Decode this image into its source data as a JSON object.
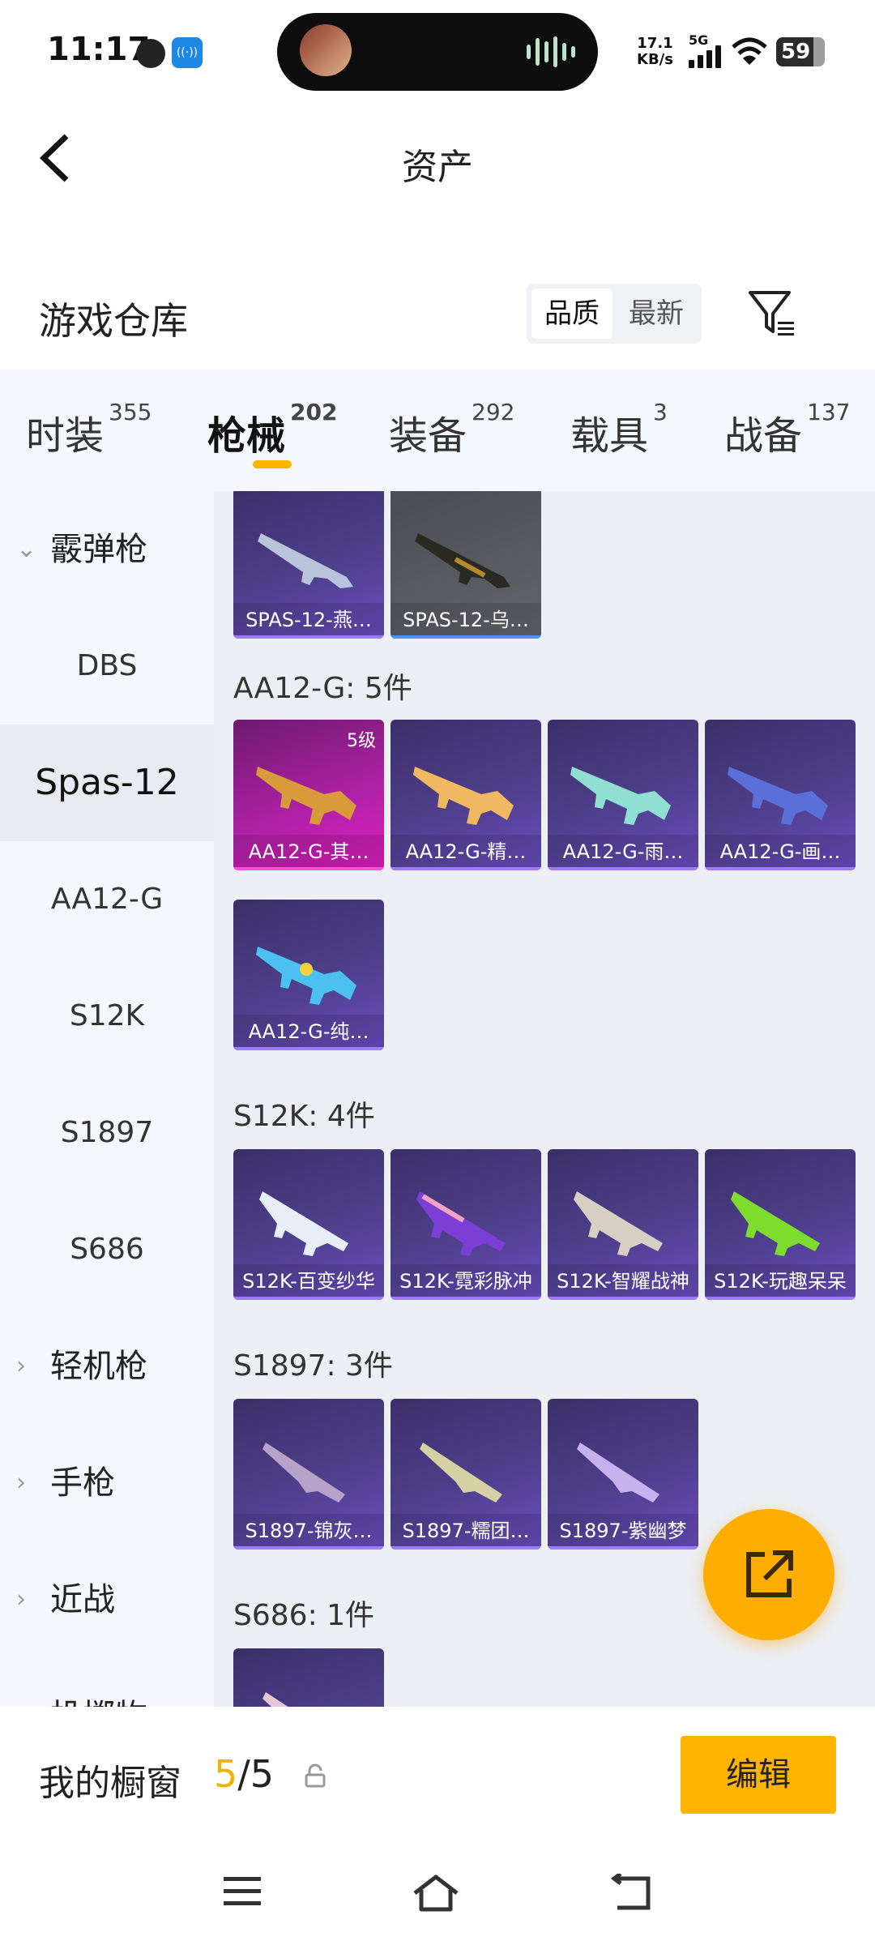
{
  "status_bar": {
    "time": "11:17",
    "net_speed_value": "17.1",
    "net_speed_unit": "KB/s",
    "network": "5G",
    "battery": "59"
  },
  "header": {
    "title": "资产"
  },
  "section": {
    "title": "游戏仓库",
    "sort_options": [
      "品质",
      "最新"
    ]
  },
  "tabs": [
    {
      "label": "时装",
      "count": "355"
    },
    {
      "label": "枪械",
      "count": "202"
    },
    {
      "label": "装备",
      "count": "292"
    },
    {
      "label": "载具",
      "count": "3"
    },
    {
      "label": "战备",
      "count": "137"
    }
  ],
  "sidebar": {
    "items": [
      {
        "label": "霰弹枪"
      },
      {
        "label": "DBS"
      },
      {
        "label": "Spas-12"
      },
      {
        "label": "AA12-G"
      },
      {
        "label": "S12K"
      },
      {
        "label": "S1897"
      },
      {
        "label": "S686"
      },
      {
        "label": "轻机枪"
      },
      {
        "label": "手枪"
      },
      {
        "label": "近战"
      },
      {
        "label": "投掷物"
      }
    ]
  },
  "groups": {
    "spas": {
      "items": [
        "SPAS-12-燕…",
        "SPAS-12-乌…"
      ]
    },
    "aa12": {
      "label": "AA12-G: 5件",
      "level": "5级",
      "items": [
        "AA12-G-其…",
        "AA12-G-精…",
        "AA12-G-雨…",
        "AA12-G-画…",
        "AA12-G-纯…"
      ]
    },
    "s12k": {
      "label": "S12K: 4件",
      "items": [
        "S12K-百变纱华",
        "S12K-霓彩脉冲",
        "S12K-智耀战神",
        "S12K-玩趣呆呆"
      ]
    },
    "s1897": {
      "label": "S1897: 3件",
      "items": [
        "S1897-锦灰…",
        "S1897-糯团…",
        "S1897-紫幽梦"
      ]
    },
    "s686": {
      "label": "S686: 1件"
    }
  },
  "bottom": {
    "showcase_label": "我的橱窗",
    "showcase_current": "5",
    "showcase_total": "/5",
    "edit_label": "编辑"
  },
  "colors": {
    "accent": "#ffb400",
    "card_purple": "#4f3f8c",
    "card_pink": "#b221a8"
  }
}
